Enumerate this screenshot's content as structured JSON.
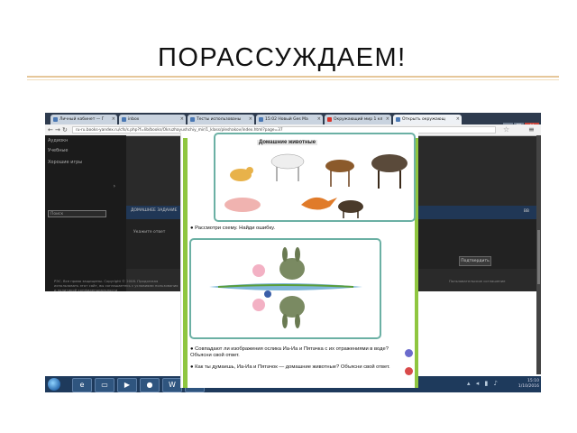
{
  "slide": {
    "title": "ПОРАССУЖДАЕМ!"
  },
  "browser": {
    "tabs": [
      {
        "label": "Личный кабинет — Г",
        "active": false
      },
      {
        "label": "inbox",
        "active": false
      },
      {
        "label": "Тесты использованы",
        "active": false
      },
      {
        "label": "15:02 Новый Ges Ma",
        "active": false
      },
      {
        "label": "Окружающий мир 1 кл",
        "active": false
      },
      {
        "label": "Открыть окружающ",
        "active": true
      }
    ],
    "url": "ru-ru.books-yandex.ru/cfs/s.php?f=lib/books/Okruzhayushchiy_mir/1_klass/pleshakov/index.html?page=37",
    "window_buttons": [
      "–",
      "□",
      "×"
    ]
  },
  "left_panel": {
    "items": [
      "Аудиокн",
      "Учебные",
      "Хорошие игры",
      "Поиск"
    ]
  },
  "page_strip": {
    "left_text": "ДОМАШНЕЕ ЗАДАНИЕ",
    "right_text": "ВВ"
  },
  "mid_panel": {
    "text": "Укажите ответ",
    "button": "Подтвердить"
  },
  "footer": {
    "left": "РЭС. Все права защищены. Copyright © 2008. Продолжая использовать этот сайт, вы соглашаетесь с условиями пользования и политикой конфиденциальности",
    "right": "Пользовательское соглашение"
  },
  "textbook": {
    "box_title": "Домашние животные",
    "prompt1": "● Рассмотри схему. Найди ошибку.",
    "q1": "● Совпадают ли изображения ослика Иа-Иа и Пятачка с их отражениями в воде? Объясни свой ответ.",
    "q2": "● Как ты думаешь, Иа-Иа и Пятачок — домашние животные? Объясни свой ответ."
  },
  "taskbar": {
    "time": "15:10",
    "date": "1/10/2016"
  },
  "colors": {
    "accent": "#8fc640",
    "box_border": "#6bb0a4",
    "taskbar": "#1e3a5c"
  }
}
